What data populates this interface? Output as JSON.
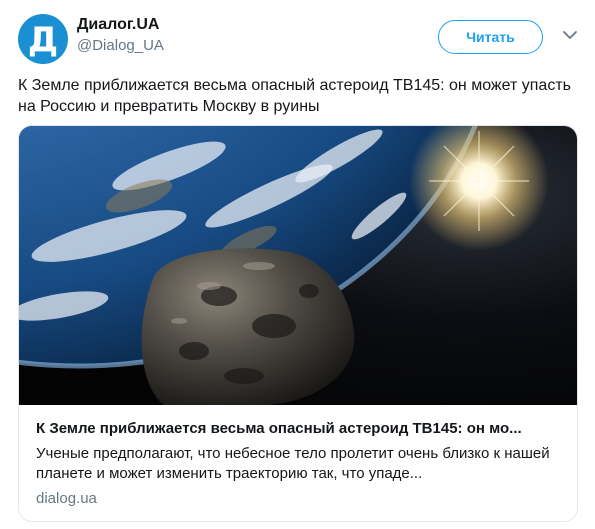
{
  "author": {
    "name": "Диалог.UA",
    "handle": "@Dialog_UA",
    "avatar_letter": "Д",
    "avatar_color": "#1a8fd1"
  },
  "actions": {
    "follow_label": "Читать",
    "menu_icon": "chevron-down-icon"
  },
  "tweet": {
    "text": "К Земле приближается весьма опасный астероид ТВ145: он может упасть на Россию и превратить Москву в руины"
  },
  "card": {
    "image_icon": "asteroid-earth-image",
    "title": "К Земле приближается весьма опасный астероид ТВ145: он мо...",
    "description": "Ученые предполагают, что небесное тело пролетит очень близко к нашей планете и может изменить траекторию так, что упаде...",
    "domain": "dialog.ua"
  },
  "colors": {
    "accent": "#1da1f2",
    "muted": "#657786",
    "text": "#14171a",
    "border": "#e1e8ed"
  }
}
